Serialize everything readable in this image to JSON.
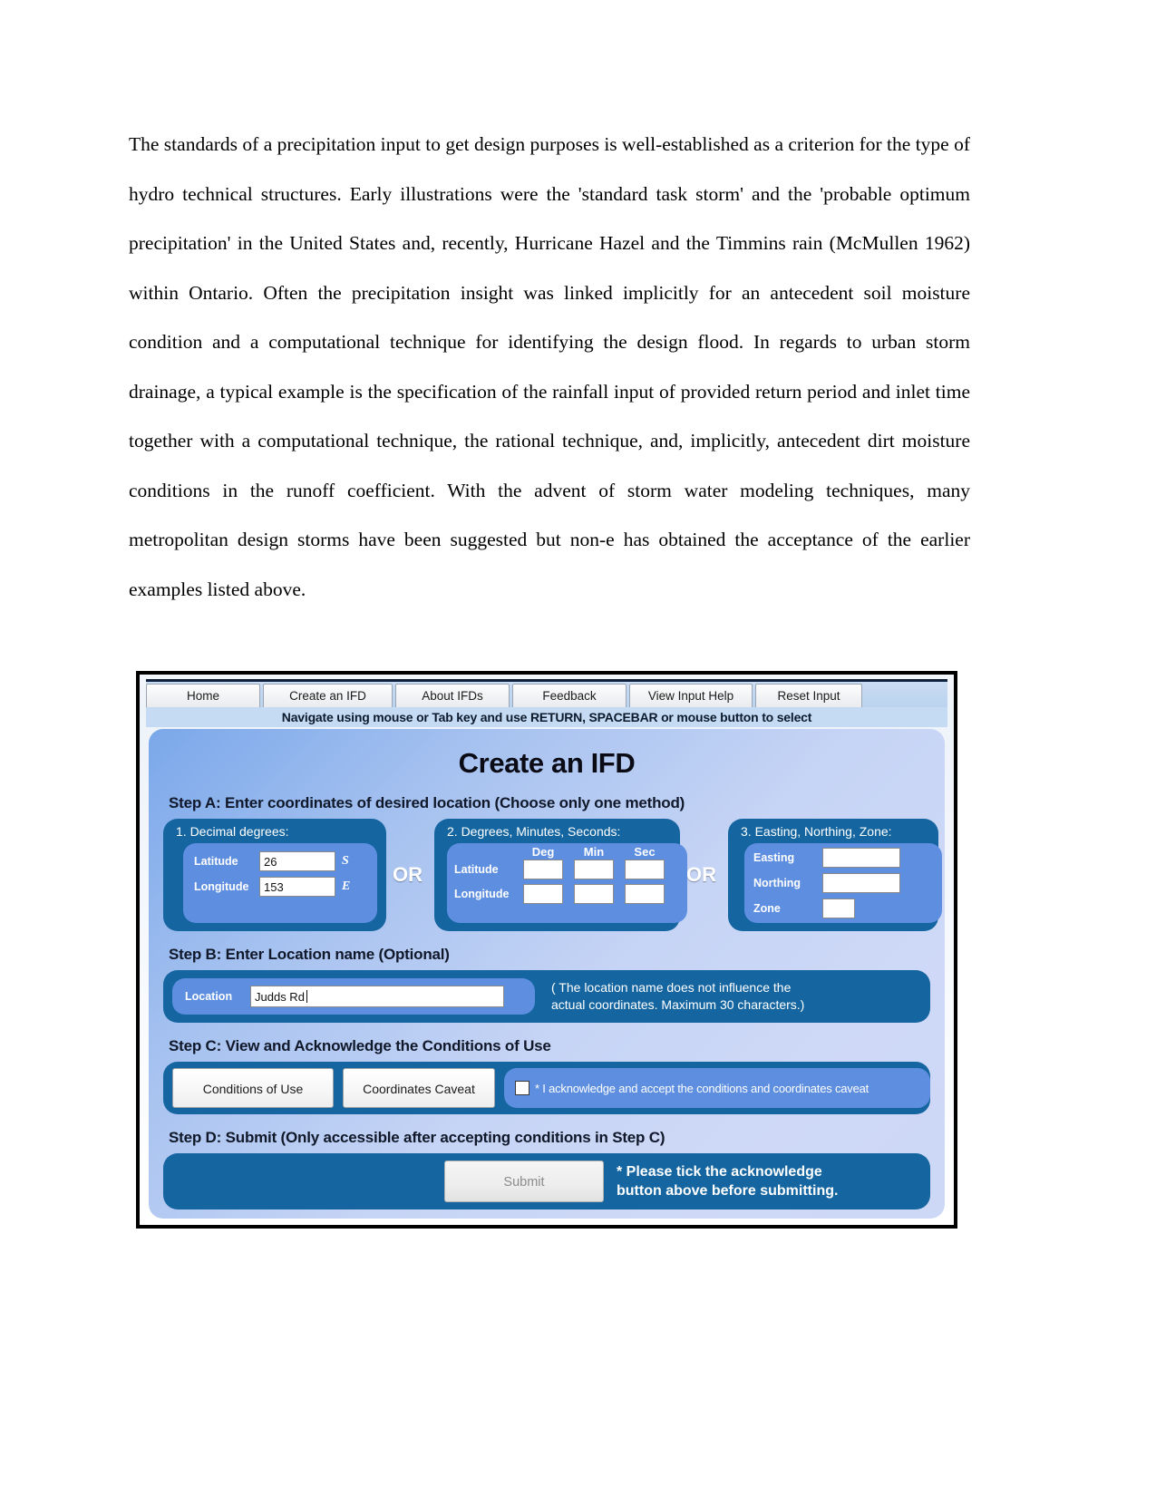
{
  "document": {
    "paragraph": "The standards of a precipitation input to get design purposes is well-established as a criterion for the type of hydro technical structures. Early illustrations were the 'standard task storm' and the 'probable optimum precipitation' in the United States and, recently, Hurricane Hazel and the Timmins rain (McMullen 1962) within Ontario. Often the precipitation insight was linked implicitly for an antecedent soil moisture condition and a computational technique for identifying the design flood. In regards to urban storm drainage, a typical example is the specification of the rainfall input of provided return period and inlet time together with a computational technique, the rational technique, and, implicitly, antecedent dirt moisture conditions in the runoff coefficient. With the advent of storm water modeling techniques, many metropolitan design storms have been suggested but non-e has obtained the acceptance of the earlier examples listed above."
  },
  "app": {
    "tabs": [
      {
        "label": "Home"
      },
      {
        "label": "Create an IFD"
      },
      {
        "label": "About IFDs"
      },
      {
        "label": "Feedback"
      },
      {
        "label": "View Input Help"
      },
      {
        "label": "Reset Input"
      }
    ],
    "nav_hint": "Navigate using mouse or Tab key and use RETURN, SPACEBAR or mouse button to select",
    "title": "Create an IFD",
    "colors": {
      "panel_dark_blue": "#1565a0",
      "inner_blue": "#5d8ee0",
      "tabstrip_blue": "#c5dbf3"
    },
    "step_a": {
      "label": "Step A: Enter coordinates of desired location (Choose only one method)",
      "or_1": "OR",
      "or_2": "OR",
      "method1": {
        "title": "1. Decimal degrees:",
        "latitude_label": "Latitude",
        "latitude_value": "26",
        "latitude_hemisphere": "S",
        "longitude_label": "Longitude",
        "longitude_value": "153",
        "longitude_hemisphere": "E"
      },
      "method2": {
        "title": "2. Degrees, Minutes, Seconds:",
        "col_deg": "Deg",
        "col_min": "Min",
        "col_sec": "Sec",
        "latitude_label": "Latitude",
        "latitude_deg": "",
        "latitude_min": "",
        "latitude_sec": "",
        "longitude_label": "Longitude",
        "longitude_deg": "",
        "longitude_min": "",
        "longitude_sec": ""
      },
      "method3": {
        "title": "3. Easting, Northing, Zone:",
        "easting_label": "Easting",
        "easting_value": "",
        "northing_label": "Northing",
        "northing_value": "",
        "zone_label": "Zone",
        "zone_value": ""
      }
    },
    "step_b": {
      "label": "Step B: Enter Location name (Optional)",
      "location_label": "Location",
      "location_value": "Judds Rd",
      "note_line1": "( The location name does not influence the",
      "note_line2": "actual coordinates. Maximum 30 characters.)"
    },
    "step_c": {
      "label": "Step C: View and Acknowledge the Conditions of Use",
      "conditions_button": "Conditions of Use",
      "caveat_button": "Coordinates Caveat",
      "acknowledge_text": "* I acknowledge and accept the conditions and coordinates caveat",
      "acknowledge_checked": false
    },
    "step_d": {
      "label": "Step D: Submit (Only accessible after accepting conditions in Step C)",
      "submit_button": "Submit",
      "note_line1": "* Please tick the acknowledge",
      "note_line2": "button above before submitting."
    }
  }
}
